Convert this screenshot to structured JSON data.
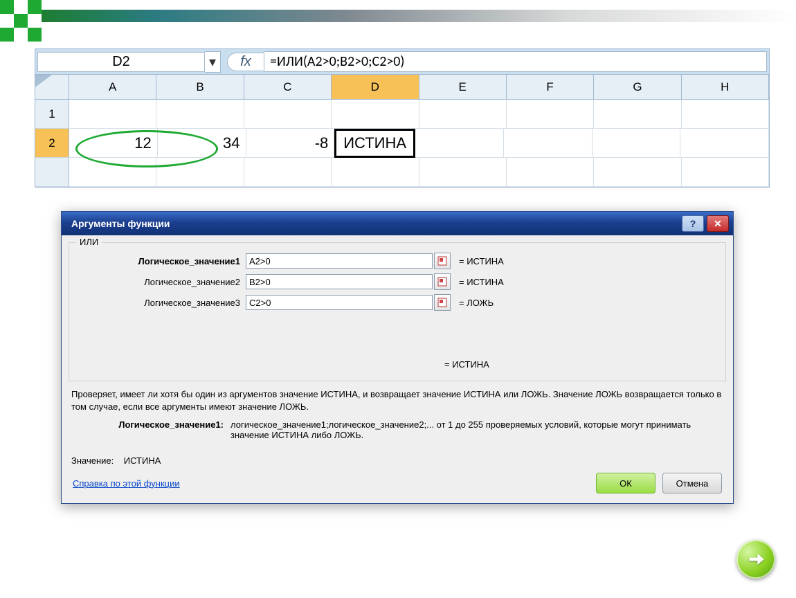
{
  "formula_bar": {
    "cell_ref": "D2",
    "fx": "fx",
    "formula": "=ИЛИ(A2>0;B2>0;C2>0)",
    "dropdown": "▾"
  },
  "columns": [
    "A",
    "B",
    "C",
    "D",
    "E",
    "F",
    "G",
    "H"
  ],
  "rows": [
    "1",
    "2"
  ],
  "cells": {
    "A2": "12",
    "B2": "34",
    "C2": "-8",
    "D2": "ИСТИНА"
  },
  "dialog": {
    "title": "Аргументы функции",
    "fn": "ИЛИ",
    "args": [
      {
        "label": "Логическое_значение1",
        "value": "A2>0",
        "eval": "= ИСТИНА",
        "bold": true
      },
      {
        "label": "Логическое_значение2",
        "value": "B2>0",
        "eval": "= ИСТИНА",
        "bold": false
      },
      {
        "label": "Логическое_значение3",
        "value": "C2>0",
        "eval": "= ЛОЖЬ",
        "bold": false
      }
    ],
    "result_eq": "= ИСТИНА",
    "description": "Проверяет, имеет ли хотя бы один из аргументов значение ИСТИНА, и возвращает значение ИСТИНА или ЛОЖЬ. Значение ЛОЖЬ возвращается только в том случае, если все аргументы имеют значение ЛОЖЬ.",
    "hint_label": "Логическое_значение1:",
    "hint_text": "логическое_значение1;логическое_значение2;... от 1 до 255 проверяемых условий, которые могут принимать значение ИСТИНА либо ЛОЖЬ.",
    "value_label": "Значение:",
    "value": "ИСТИНА",
    "help": "Справка по этой функции",
    "ok": "ОК",
    "cancel": "Отмена",
    "help_icon": "?",
    "close_icon": "✕"
  }
}
